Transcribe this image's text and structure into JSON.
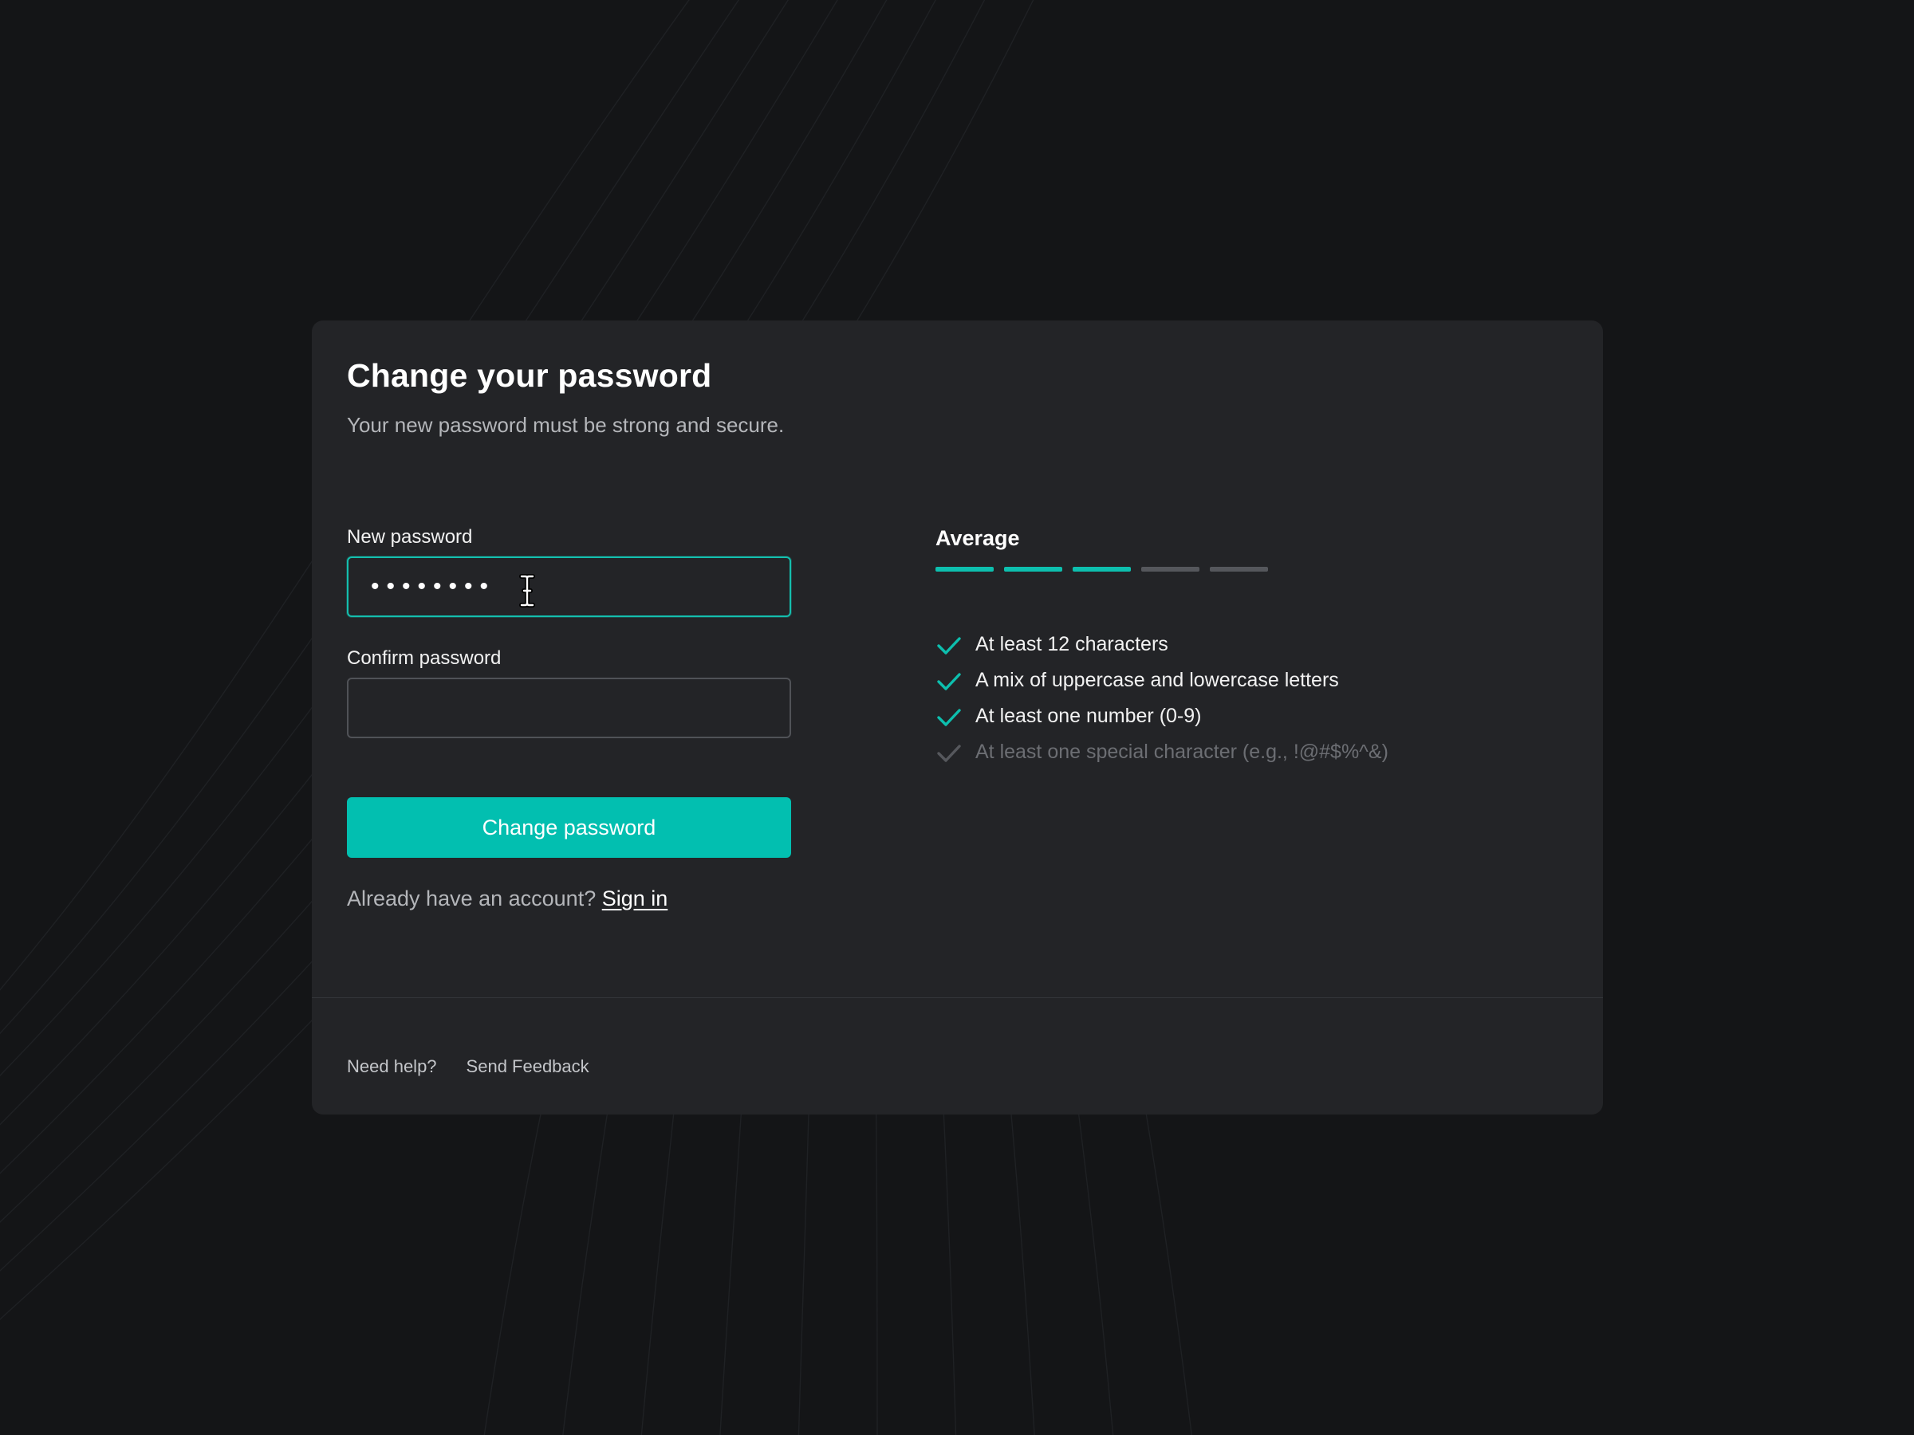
{
  "card": {
    "title": "Change your password",
    "subtitle": "Your new password must be strong and secure."
  },
  "form": {
    "new_password_label": "New password",
    "new_password_value": "••••••••",
    "confirm_password_label": "Confirm password",
    "confirm_password_value": "",
    "submit_label": "Change password",
    "signin_prompt": "Already have an account?",
    "signin_link": "Sign in"
  },
  "strength": {
    "label": "Average",
    "segments_total": 5,
    "segments_filled": 3
  },
  "requirements": [
    {
      "text": "At least 12 characters",
      "met": true
    },
    {
      "text": "A mix of uppercase and lowercase letters",
      "met": true
    },
    {
      "text": "At least one number (0-9)",
      "met": true
    },
    {
      "text": "At least one special character (e.g., !@#$%^&)",
      "met": false
    }
  ],
  "footer": {
    "help": "Need help?",
    "feedback": "Send Feedback"
  },
  "colors": {
    "accent": "#02bfb0",
    "background": "#141517",
    "card": "#232427",
    "muted_text": "#b4b6ba",
    "disabled": "#6c6e73"
  },
  "icons": {
    "check": "check-icon",
    "text_cursor": "text-cursor-icon"
  }
}
